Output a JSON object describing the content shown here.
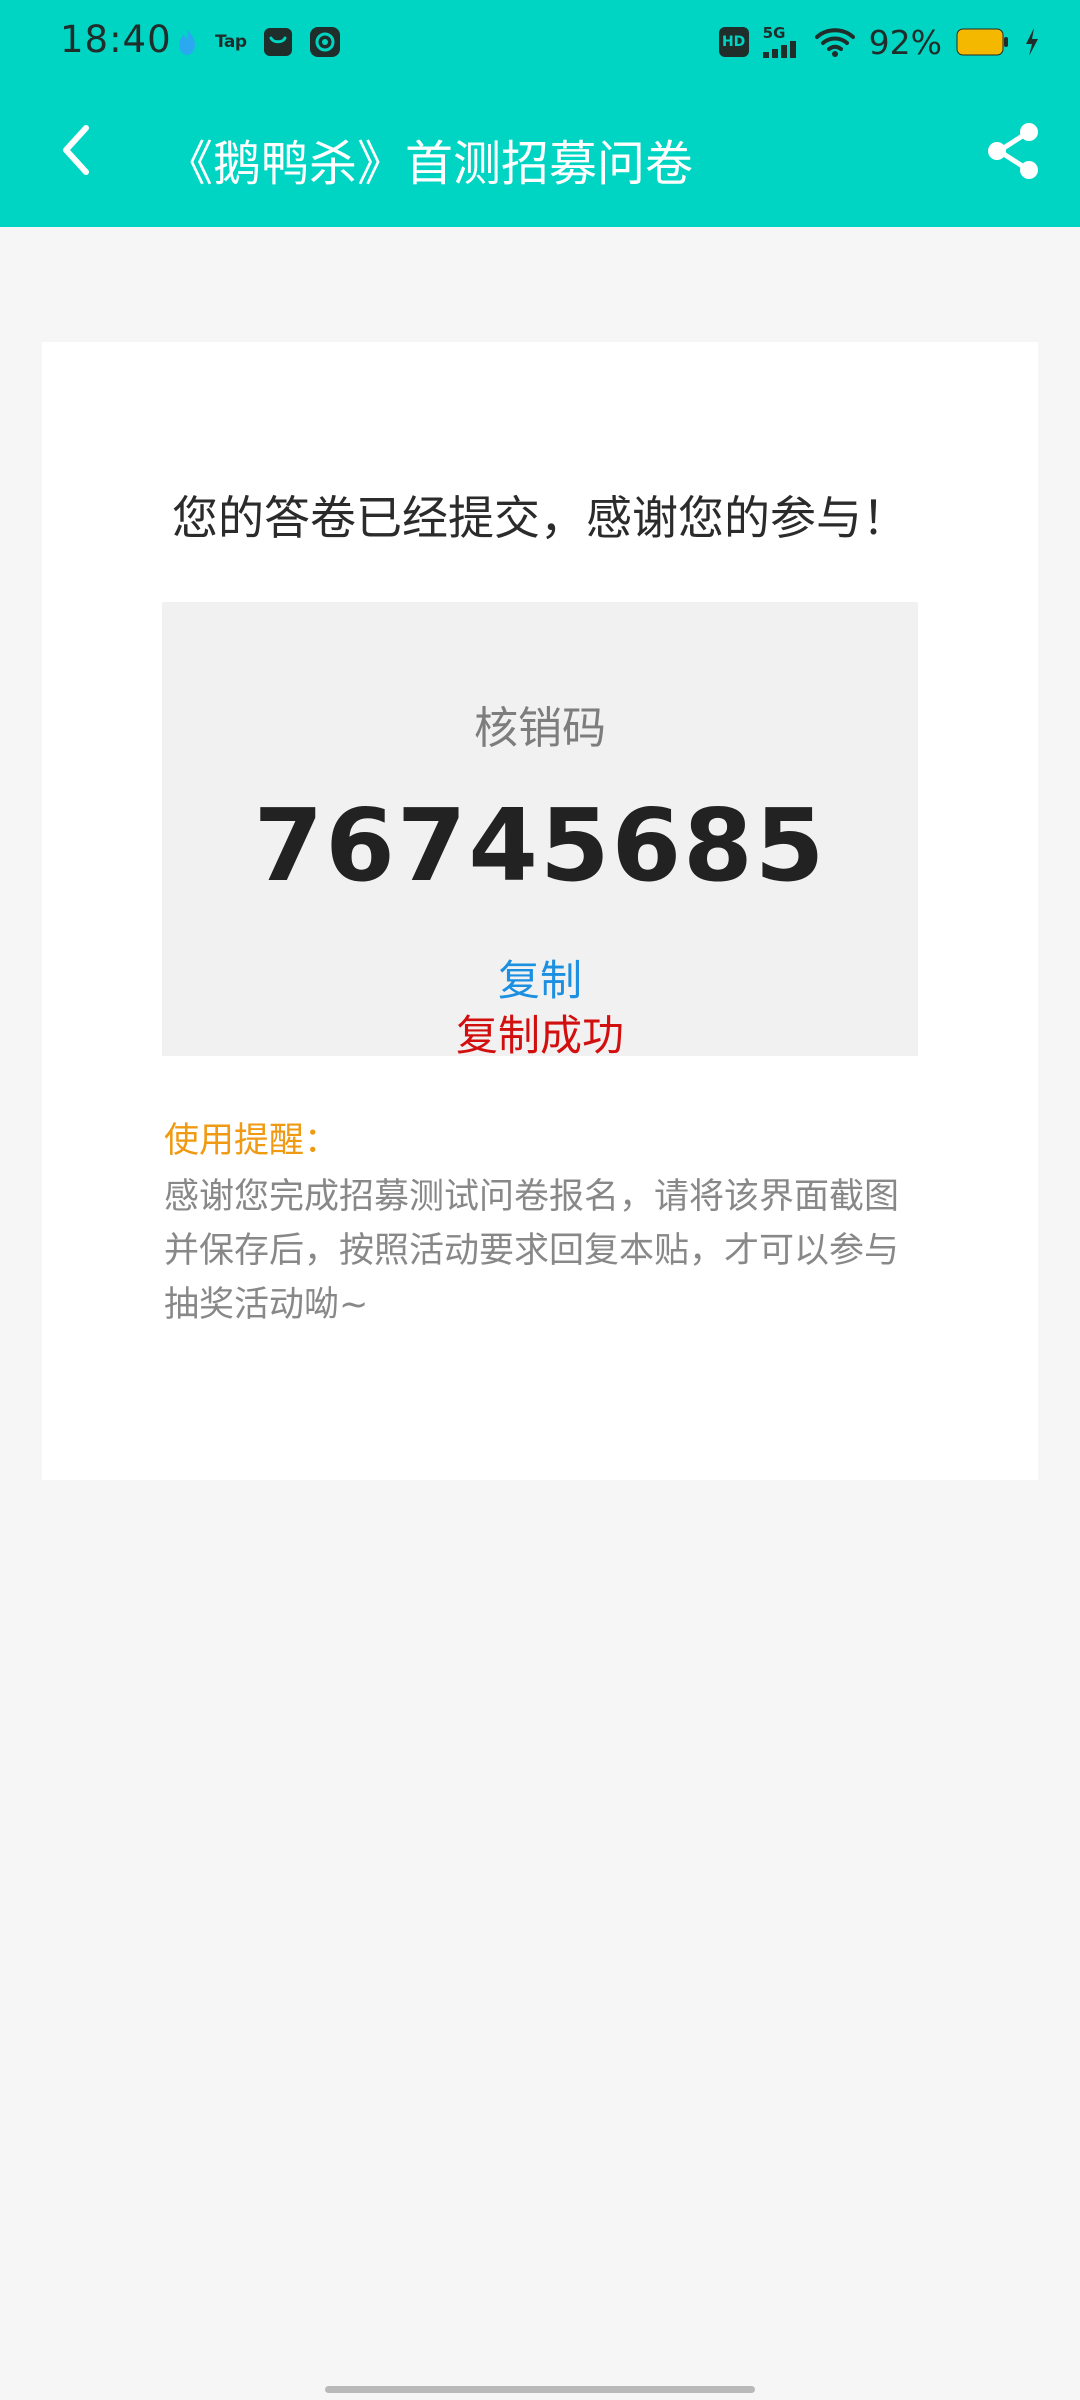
{
  "status_bar": {
    "time": "18:40",
    "left_icons": [
      "flame-icon",
      "taptap-icon",
      "taobao-icon",
      "app-icon"
    ],
    "taptap_text": "Tap",
    "hd_text": "HD",
    "network_text": "5G",
    "battery_percent": "92%"
  },
  "navbar": {
    "title": "《鹅鸭杀》首测招募问卷"
  },
  "result": {
    "submitted_message": "您的答卷已经提交，感谢您的参与！",
    "code_label": "核销码",
    "code_value": "76745685",
    "copy_label": "复制",
    "copy_success": "复制成功"
  },
  "reminder": {
    "title": "使用提醒：",
    "lines": [
      "感谢您完成招募测试问卷报名，请将该界面截图",
      "并保存后，按照活动要求回复本贴，才可以参与",
      "抽奖活动呦~"
    ]
  },
  "colors": {
    "accent": "#00d5c3",
    "link": "#1b8fe0",
    "success": "#d20f0f",
    "warning": "#f09a13",
    "battery": "#f5b800"
  }
}
